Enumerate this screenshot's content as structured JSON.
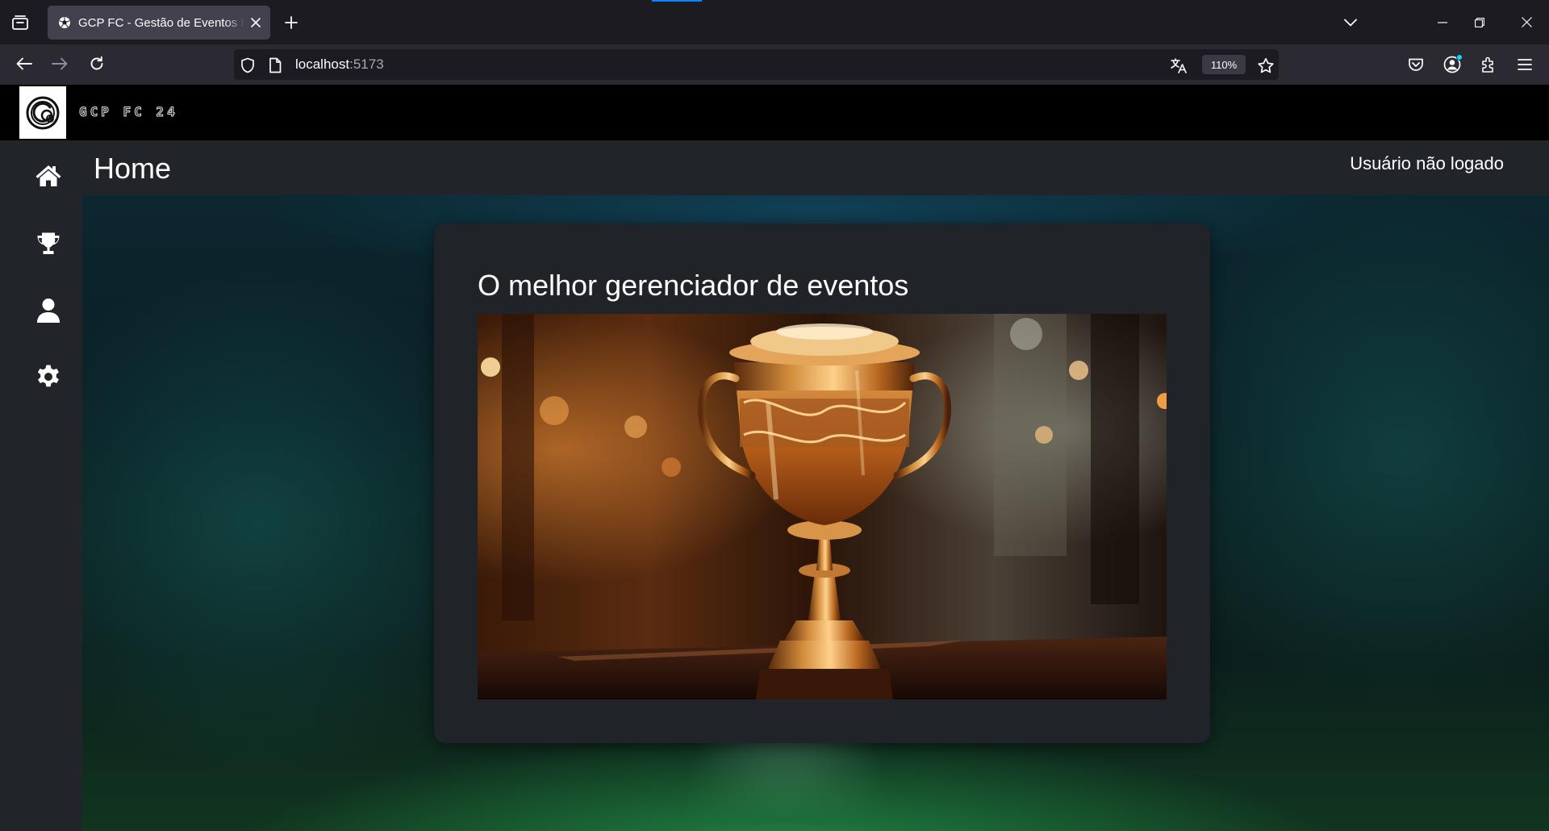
{
  "browser": {
    "tab": {
      "title": "GCP FC - Gestão de Eventos Esportivos"
    },
    "url": {
      "host": "localhost",
      "port": ":5173"
    },
    "zoom": "110%",
    "icons": {
      "tab_list": "tab-list-icon",
      "favicon": "soccer-ball-icon",
      "new_tab": "plus-icon",
      "back": "arrow-left-icon",
      "forward": "arrow-right-icon",
      "reload": "reload-icon",
      "tracking": "shield-icon",
      "page": "page-icon",
      "translate": "translate-icon",
      "bookmark": "star-icon",
      "pocket": "pocket-icon",
      "account": "account-icon",
      "extensions": "puzzle-icon",
      "menu": "hamburger-icon"
    }
  },
  "app": {
    "brand": "GCP FC 24",
    "sidebar": [
      {
        "name": "home",
        "icon": "home-icon"
      },
      {
        "name": "events",
        "icon": "trophy-icon"
      },
      {
        "name": "profile",
        "icon": "user-icon"
      },
      {
        "name": "settings",
        "icon": "gear-icon"
      }
    ],
    "page_title": "Home",
    "user_status": "Usuário não logado",
    "card": {
      "title": "O melhor gerenciador de eventos",
      "image": "trophy-photo"
    },
    "colors": {
      "header_bg": "#000000",
      "sidebar_bg": "#212529",
      "card_bg": "#202327",
      "text": "#ffffff"
    }
  }
}
